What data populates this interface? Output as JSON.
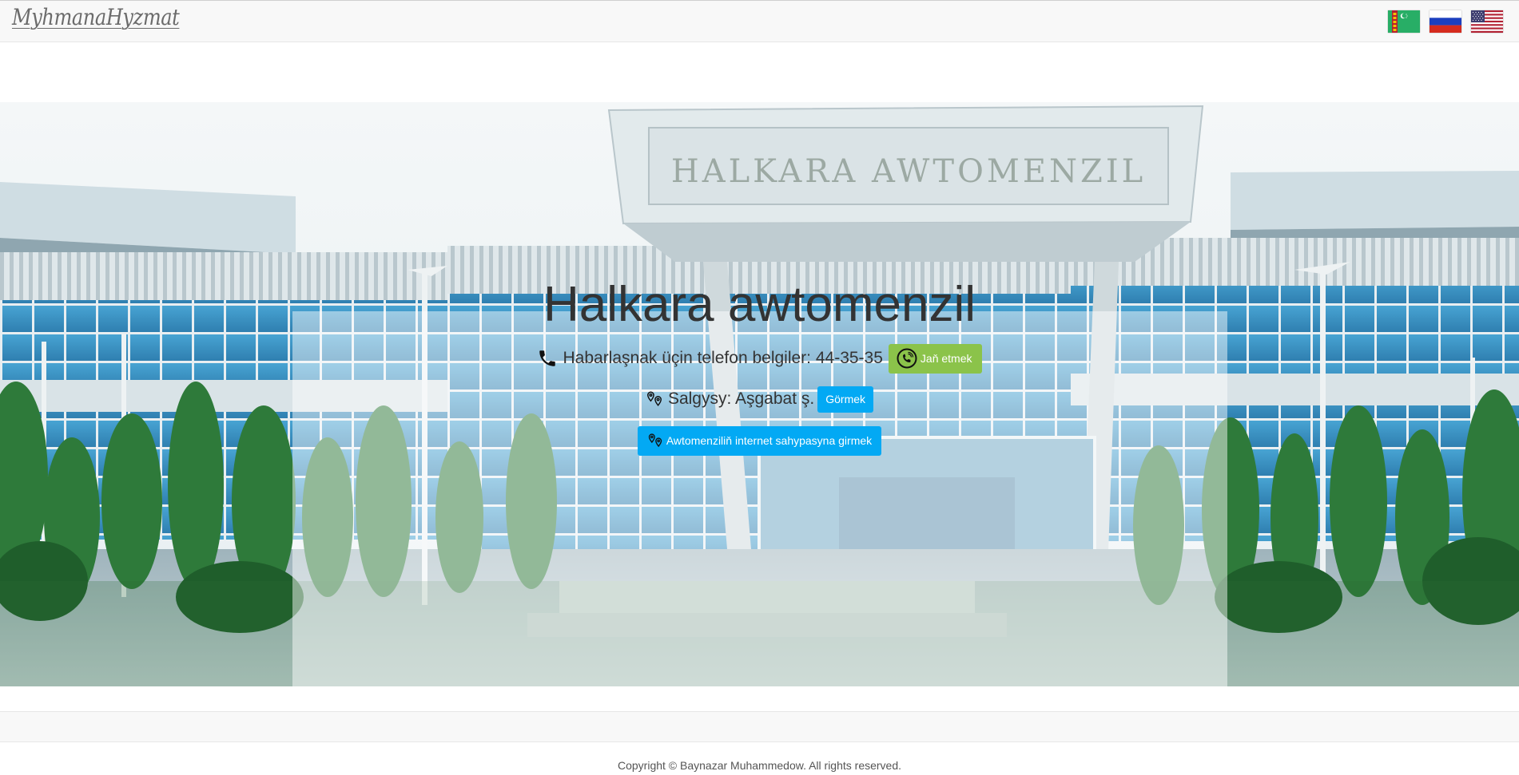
{
  "brand": {
    "logo_text": "MyhmanaHyzmat"
  },
  "languages": [
    {
      "name": "Turkmen",
      "icon": "turkmenistan-flag-icon"
    },
    {
      "name": "Russian",
      "icon": "russia-flag-icon"
    },
    {
      "name": "English",
      "icon": "usa-flag-icon"
    }
  ],
  "hero": {
    "sign_text": "HALKARA AWTOMENZIL",
    "title": "Halkara awtomenzil",
    "phone": {
      "icon": "phone-icon",
      "text": "Habarlaşnak üçin telefon belgiler: 44-35-35",
      "call_button": "Jaň etmek",
      "call_icon": "phone-call-icon"
    },
    "address": {
      "icon": "map-pins-icon",
      "text": "Salgysy: Aşgabat ş.",
      "view_button": "Görmek"
    },
    "website_button": "Awtomenziliň internet sahypasyna girmek",
    "website_icon": "map-pins-icon"
  },
  "footer": {
    "copyright": "Copyright © Baynazar Muhammedow. All rights reserved."
  },
  "colors": {
    "call_button": "#8bc34a",
    "info_button": "#03a9f4",
    "navbar": "#f8f8f8"
  }
}
